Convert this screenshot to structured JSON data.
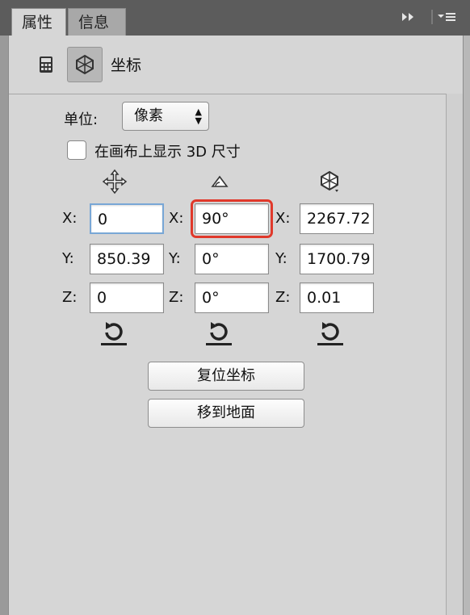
{
  "tabs": [
    {
      "label": "属性",
      "active": true
    },
    {
      "label": "信息",
      "active": false
    }
  ],
  "panel_menu": {
    "collapse_icon": "double-chevron-right-icon",
    "menu_icon": "panel-menu-icon"
  },
  "header": {
    "title": "坐标",
    "icons": [
      "calculator-icon",
      "3d-coordinates-icon"
    ]
  },
  "unit": {
    "label": "单位:",
    "value": "像素"
  },
  "show_3d_size": {
    "label": "在画布上显示 3D 尺寸",
    "checked": false
  },
  "columns": [
    {
      "name": "position",
      "icon": "move-icon",
      "x_label": "X:",
      "x": "0",
      "y_label": "Y:",
      "y": "850.39",
      "z_label": "Z:",
      "z": "0"
    },
    {
      "name": "rotation",
      "icon": "rotate-icon",
      "x_label": "X:",
      "x": "90°",
      "y_label": "Y:",
      "y": "0°",
      "z_label": "Z:",
      "z": "0°"
    },
    {
      "name": "scale",
      "icon": "scale-3d-icon",
      "x_label": "X:",
      "x": "2267.72",
      "y_label": "Y:",
      "y": "1700.79",
      "z_label": "Z:",
      "z": "0.01"
    }
  ],
  "buttons": {
    "reset_coords": "复位坐标",
    "move_to_ground": "移到地面"
  },
  "colors": {
    "highlight": "#e0392b",
    "focus": "#79a7d6",
    "panel_bg": "#d6d6d6"
  }
}
